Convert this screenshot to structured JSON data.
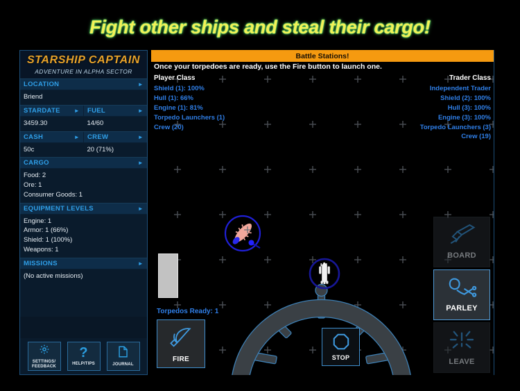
{
  "promo": {
    "text": "Fight other ships and steal their cargo!",
    "color": "#f2f257",
    "glow": "#3a8f46"
  },
  "sidebar": {
    "title": "STARSHIP CAPTAIN",
    "subtitle": "ADVENTURE IN ALPHA SECTOR",
    "title_color": "#e8a32a",
    "sections": [
      {
        "label": "LOCATION",
        "arrow": "►",
        "value": "Briend"
      },
      {
        "label": "STARDATE",
        "arrow": "►",
        "value": "3459.30",
        "label2": "FUEL",
        "arrow2": "►",
        "value2": "14/60"
      },
      {
        "label": "CASH",
        "arrow": "►",
        "value": "50c",
        "label2": "CREW",
        "arrow2": "►",
        "value2": "20 (71%)"
      },
      {
        "label": "CARGO",
        "arrow": "►",
        "lines": [
          "Food: 2",
          "Ore: 1",
          "Consumer Goods: 1"
        ]
      },
      {
        "label": "EQUIPMENT LEVELS",
        "arrow": "►",
        "lines": [
          "Engine: 1",
          "Armor: 1 (66%)",
          "Shield: 1 (100%)",
          "Weapons: 1"
        ]
      },
      {
        "label": "MISSIONS",
        "arrow": "►",
        "value": "(No active missions)"
      }
    ],
    "cargo": {
      "food": "Food: 2",
      "ore": "Ore: 1",
      "consumer": "Consumer Goods: 1"
    },
    "equipment": {
      "engine": "Engine: 1",
      "armor": "Armor: 1 (66%)",
      "shield": "Shield: 1 (100%)",
      "weapons": "Weapons: 1"
    },
    "missions_text": "(No active missions)",
    "buttons": [
      {
        "label_line1": "SETTINGS/",
        "label_line2": "FEEDBACK",
        "icon": "gear-icon"
      },
      {
        "label_line1": "HELP/TIPS",
        "label_line2": "",
        "icon": "question-mark-icon"
      },
      {
        "label_line1": "JOURNAL",
        "label_line2": "",
        "icon": "book-page-icon"
      }
    ]
  },
  "battle": {
    "header": "Battle Stations!",
    "header_bg": "#f59a10",
    "instruction": "Once your torpedoes are ready, use the Fire button to launch one.",
    "player": {
      "class_label": "Player Class",
      "stats": [
        "Shield (1): 100%",
        "Hull (1): 66%",
        "Engine (1): 81%",
        "Torpedo Launchers (1)",
        "Crew (20)"
      ]
    },
    "trader": {
      "class_label": "Trader Class",
      "stats": [
        "Independent Trader",
        "Shield (2): 100%",
        "Hull (3): 100%",
        "Engine (3): 100%",
        "Torpedo Launchers (3)",
        "Crew (19)"
      ]
    },
    "torpedo_ready_label": "Torpedos Ready: 1",
    "torpedo_bar_percent": 100,
    "fire_button_label": "FIRE",
    "stop_button_label": "STOP"
  },
  "actions": [
    {
      "label": "BOARD",
      "icon": "boarding-gun-icon",
      "state": "disabled"
    },
    {
      "label": "PARLEY",
      "icon": "speech-scissors-icon",
      "state": "active"
    },
    {
      "label": "LEAVE",
      "icon": "warp-burst-icon",
      "state": "disabled"
    }
  ]
}
